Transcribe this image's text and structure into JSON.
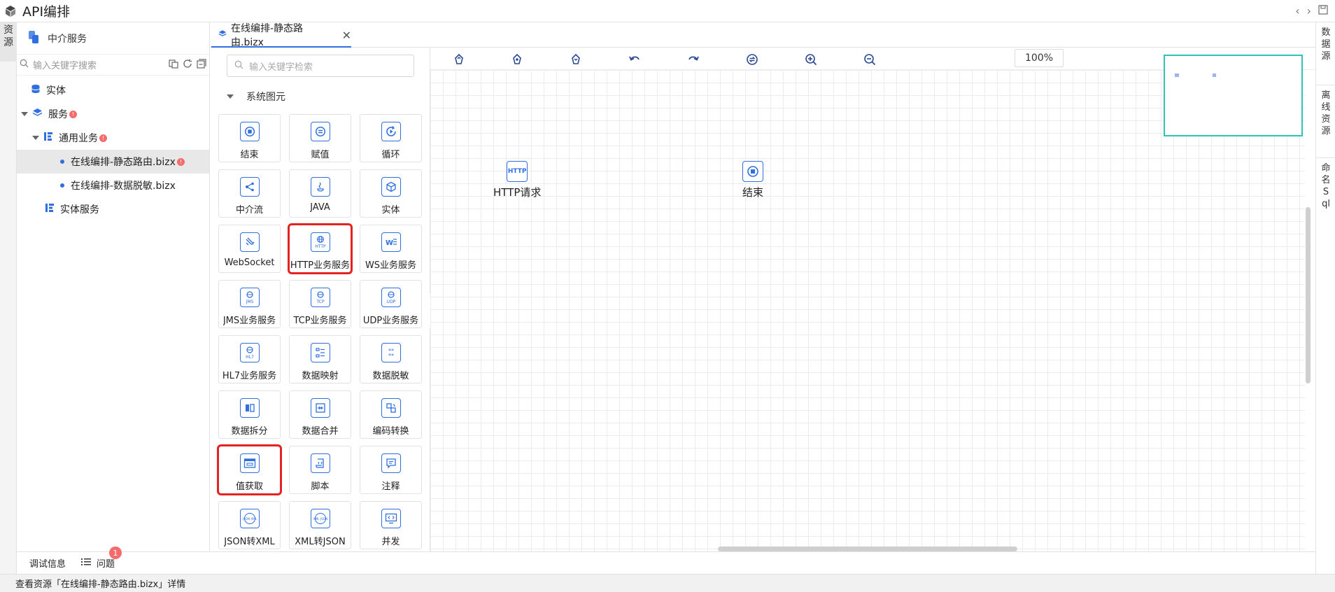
{
  "app": {
    "title": "API编排"
  },
  "left_strip": {
    "tab_label": "资源"
  },
  "resource_panel": {
    "header": "中介服务",
    "search_placeholder": "输入关键字搜索",
    "tree": [
      {
        "label": "实体",
        "icon": "database-icon"
      },
      {
        "label": "服务",
        "icon": "layers-icon",
        "badge": "!",
        "expanded": true
      },
      {
        "label": "通用业务",
        "icon": "tree-structure-icon",
        "badge": "!",
        "expanded": true
      },
      {
        "label": "在线编排-静态路由.bizx",
        "badge": "!",
        "selected": true
      },
      {
        "label": "在线编排-数据脱敏.bizx"
      },
      {
        "label": "实体服务",
        "icon": "tree-structure-icon"
      }
    ]
  },
  "editor": {
    "tab_label": "在线编排-静态路由.bizx",
    "close_glyph": "✕"
  },
  "palette": {
    "search_placeholder": "输入关键字检索",
    "group_label": "系统图元",
    "items": [
      {
        "label": "结束",
        "icon": "stop-icon"
      },
      {
        "label": "赋值",
        "icon": "equals-icon"
      },
      {
        "label": "循环",
        "icon": "loop-icon"
      },
      {
        "label": "中介流",
        "icon": "flow-icon"
      },
      {
        "label": "JAVA",
        "icon": "java-icon"
      },
      {
        "label": "实体",
        "icon": "cube-icon"
      },
      {
        "label": "WebSocket",
        "icon": "websocket-icon"
      },
      {
        "label": "HTTP业务服务",
        "icon": "http-globe-icon",
        "highlighted": true
      },
      {
        "label": "WS业务服务",
        "icon": "ws-icon"
      },
      {
        "label": "JMS业务服务",
        "icon": "jms-icon"
      },
      {
        "label": "TCP业务服务",
        "icon": "tcp-icon"
      },
      {
        "label": "UDP业务服务",
        "icon": "udp-icon"
      },
      {
        "label": "HL7业务服务",
        "icon": "hl7-icon"
      },
      {
        "label": "数据映射",
        "icon": "mapping-icon"
      },
      {
        "label": "数据脱敏",
        "icon": "mask-icon"
      },
      {
        "label": "数据拆分",
        "icon": "split-icon"
      },
      {
        "label": "数据合并",
        "icon": "merge-icon"
      },
      {
        "label": "编码转换",
        "icon": "convert-icon"
      },
      {
        "label": "值获取",
        "icon": "value-fetch-icon",
        "highlighted": true
      },
      {
        "label": "脚本",
        "icon": "script-icon"
      },
      {
        "label": "注释",
        "icon": "comment-icon"
      },
      {
        "label": "JSON转XML",
        "icon": "json-xml-icon"
      },
      {
        "label": "XML转JSON",
        "icon": "xml-json-icon"
      },
      {
        "label": "并发",
        "icon": "concurrent-icon"
      }
    ]
  },
  "toolbar": {
    "zoom": "100%",
    "buttons": [
      "align-top-icon",
      "align-center-icon",
      "align-bottom-icon",
      "undo-icon",
      "redo-icon",
      "swap-icon",
      "zoom-in-icon",
      "zoom-out-icon"
    ]
  },
  "canvas": {
    "nodes": [
      {
        "label": "HTTP请求",
        "icon_text": "HTTP"
      },
      {
        "label": "结束",
        "icon": "stop-icon"
      }
    ]
  },
  "right_strip": {
    "tabs": [
      "数据源",
      "离线资源",
      "命名Sql"
    ]
  },
  "bottom_bar": {
    "debug_label": "调试信息",
    "issues_label": "问题",
    "issues_count": "1"
  },
  "status_bar": {
    "text": "查看资源「在线编排-静态路由.bizx」详情"
  },
  "colors": {
    "accent": "#2f6fe0",
    "highlight": "#e52222",
    "minimap_border": "#2ec4b6",
    "badge": "#f56c6c"
  }
}
